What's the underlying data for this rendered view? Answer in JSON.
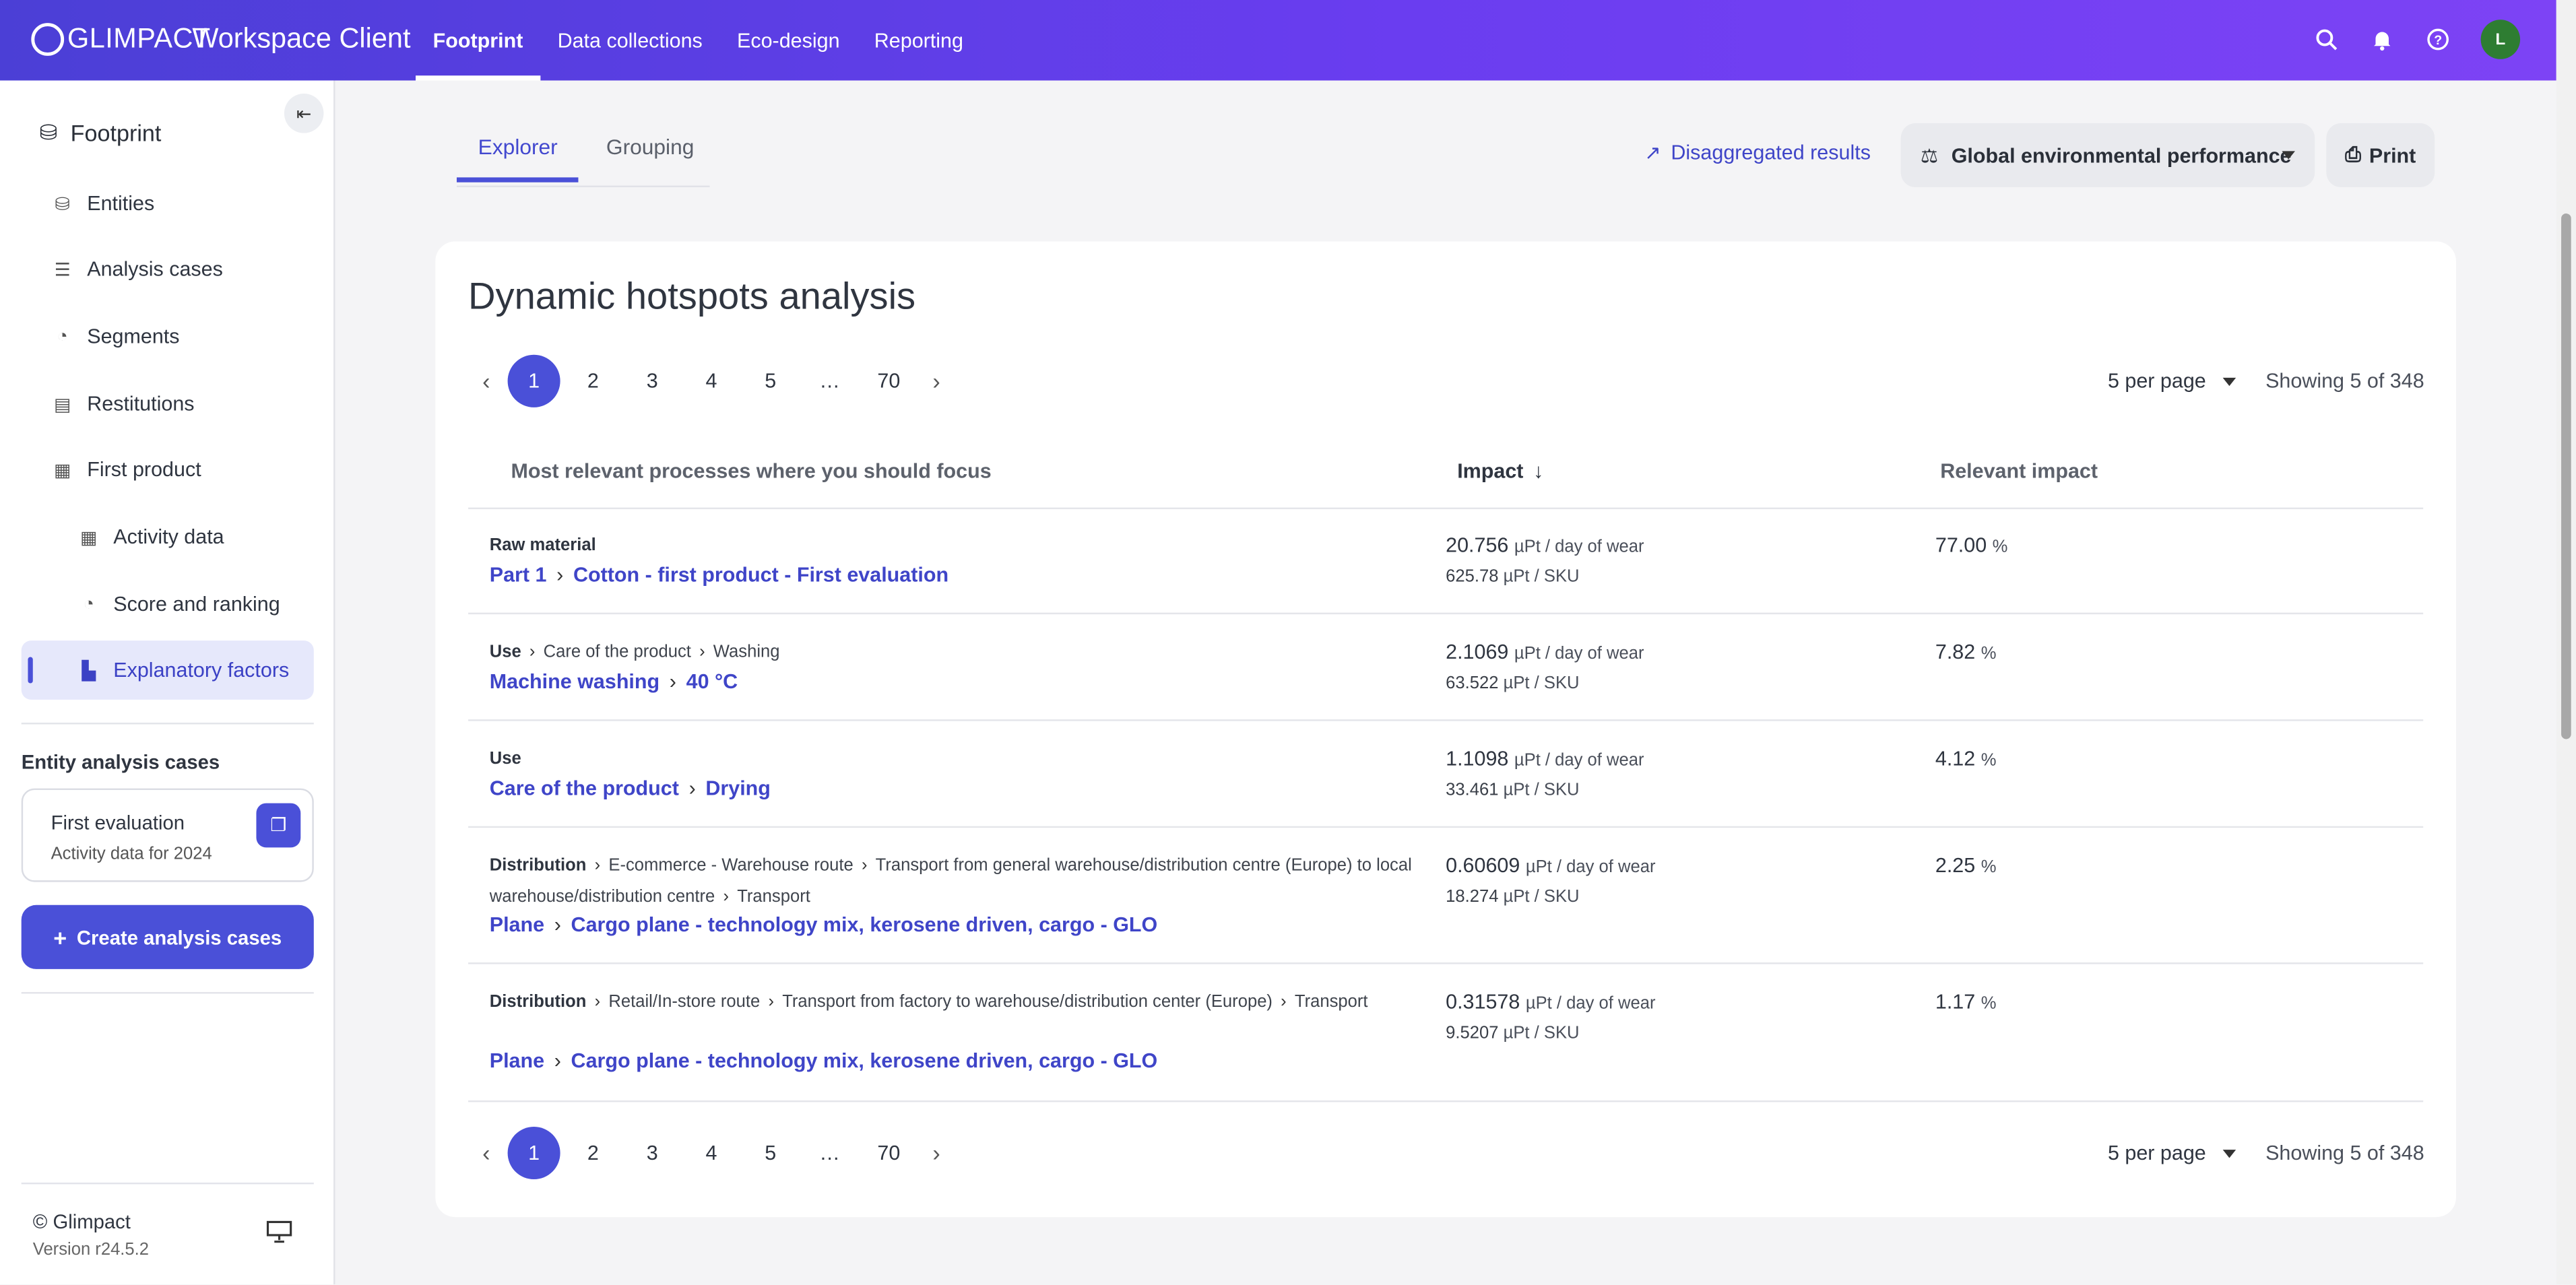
{
  "header": {
    "logo_text": "GLIMPACT",
    "app_title": "Workspace Client",
    "nav": [
      "Footprint",
      "Data collections",
      "Eco-design",
      "Reporting"
    ],
    "active_nav": "Footprint",
    "icons": [
      "search-icon",
      "bell-icon",
      "help-icon"
    ],
    "avatar_initial": "L",
    "brand_color": "#5a3fe6"
  },
  "sidebar": {
    "title": "Footprint",
    "items": [
      {
        "label": "Entities",
        "icon": "entities-icon"
      },
      {
        "label": "Analysis cases",
        "icon": "analysis-icon"
      },
      {
        "label": "Segments",
        "icon": "segments-icon"
      },
      {
        "label": "Restitutions",
        "icon": "restitutions-icon"
      },
      {
        "label": "First product",
        "icon": "product-icon"
      },
      {
        "label": "Activity data",
        "icon": "table-icon"
      },
      {
        "label": "Score and ranking",
        "icon": "score-icon"
      },
      {
        "label": "Explanatory factors",
        "icon": "chart-icon"
      }
    ],
    "active_item": "Explanatory factors",
    "section_title": "Entity analysis cases",
    "case_card": {
      "title": "First evaluation",
      "subtitle": "Activity data for 2024"
    },
    "create_button": "Create analysis cases",
    "copyright": "© Glimpact",
    "version": "Version r24.5.2"
  },
  "main": {
    "tabs": [
      "Explorer",
      "Grouping"
    ],
    "active_tab": "Explorer",
    "disaggregated_label": "Disaggregated results",
    "performance_select": "Global environmental performance",
    "print_label": "Print",
    "card_title": "Dynamic hotspots analysis",
    "pagination": {
      "prev": "‹",
      "pages": [
        "1",
        "2",
        "3",
        "4",
        "5",
        "…",
        "70"
      ],
      "next": "›",
      "current": "1"
    },
    "per_page": "5 per page",
    "showing": "Showing 5 of 348",
    "columns": [
      "Most relevant processes where you should focus",
      "Impact",
      "Relevant impact"
    ],
    "rows": [
      {
        "path_bold": "Raw material",
        "path_rest": [],
        "link": [
          "Part 1",
          "Cotton - first product - First evaluation"
        ],
        "impact_day_value": "20.756",
        "impact_day_unit": "µPt / day of wear",
        "impact_sku_value": "625.78",
        "impact_sku_unit": "µPt / SKU",
        "relevant_value": "77.00",
        "relevant_unit": "%"
      },
      {
        "path_bold": "Use",
        "path_rest": [
          "Care of the product",
          "Washing"
        ],
        "link": [
          "Machine washing",
          "40 °C"
        ],
        "impact_day_value": "2.1069",
        "impact_day_unit": "µPt / day of wear",
        "impact_sku_value": "63.522",
        "impact_sku_unit": "µPt / SKU",
        "relevant_value": "7.82",
        "relevant_unit": "%"
      },
      {
        "path_bold": "Use",
        "path_rest": [],
        "link": [
          "Care of the product",
          "Drying"
        ],
        "impact_day_value": "1.1098",
        "impact_day_unit": "µPt / day of wear",
        "impact_sku_value": "33.461",
        "impact_sku_unit": "µPt / SKU",
        "relevant_value": "4.12",
        "relevant_unit": "%"
      },
      {
        "path_bold": "Distribution",
        "path_rest": [
          "E-commerce - Warehouse route",
          "Transport from general warehouse/distribution centre (Europe) to local warehouse/distribution centre",
          "Transport"
        ],
        "link": [
          "Plane",
          "Cargo plane - technology mix, kerosene driven, cargo - GLO"
        ],
        "impact_day_value": "0.60609",
        "impact_day_unit": "µPt / day of wear",
        "impact_sku_value": "18.274",
        "impact_sku_unit": "µPt / SKU",
        "relevant_value": "2.25",
        "relevant_unit": "%"
      },
      {
        "path_bold": "Distribution",
        "path_rest": [
          "Retail/In-store route",
          "Transport from factory to warehouse/distribution center (Europe)",
          "Transport"
        ],
        "link": [
          "Plane",
          "Cargo plane - technology mix, kerosene driven, cargo - GLO"
        ],
        "impact_day_value": "0.31578",
        "impact_day_unit": "µPt / day of wear",
        "impact_sku_value": "9.5207",
        "impact_sku_unit": "µPt / SKU",
        "relevant_value": "1.17",
        "relevant_unit": "%"
      }
    ]
  }
}
